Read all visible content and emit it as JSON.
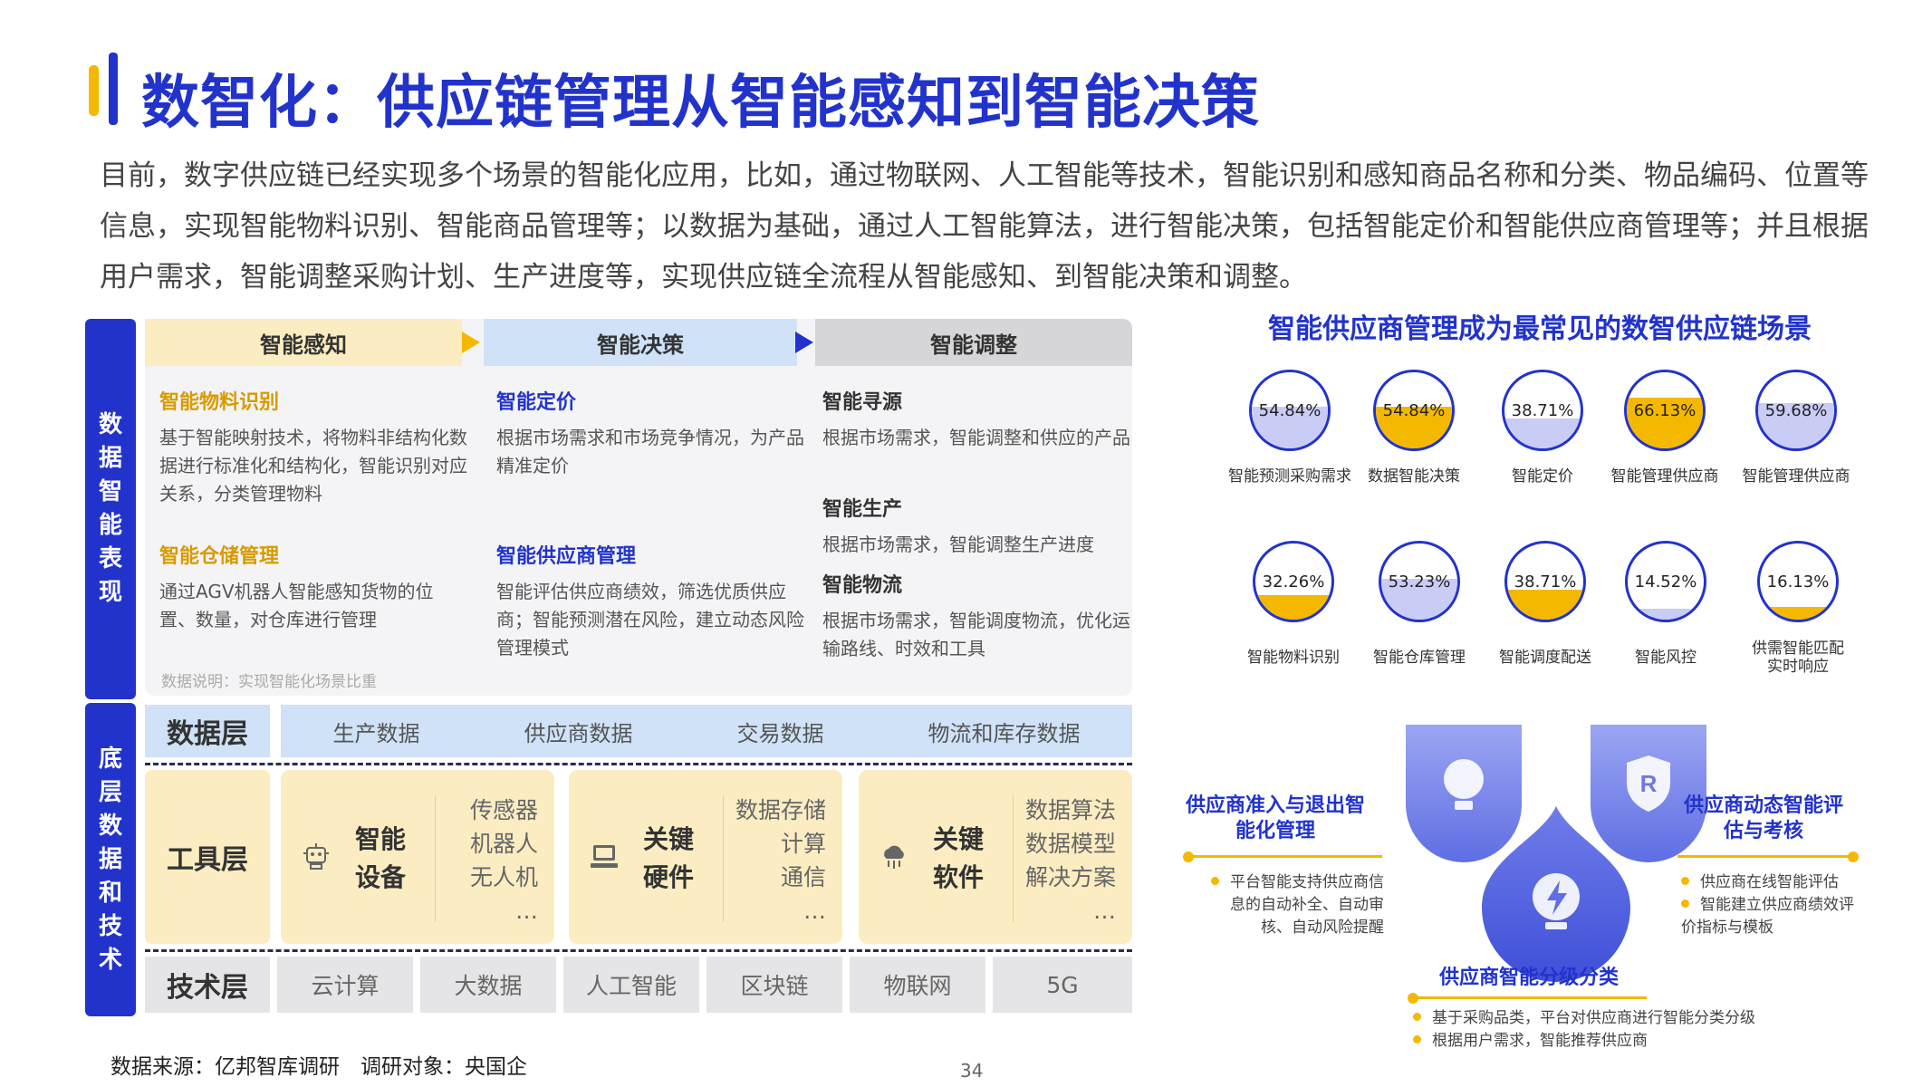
{
  "title": "数智化：供应链管理从智能感知到智能决策",
  "intro": "目前，数字供应链已经实现多个场景的智能化应用，比如，通过物联网、人工智能等技术，智能识别和感知商品名称和分类、物品编码、位置等信息，实现智能物料识别、智能商品管理等；以数据为基础，通过人工智能算法，进行智能决策，包括智能定价和智能供应商管理等；并且根据用户需求，智能调整采购计划、生产进度等，实现供应链全流程从智能感知、到智能决策和调整。",
  "left": {
    "side_top": "数据智能表现",
    "side_bottom": "底层数据和技术",
    "headers": [
      "智能感知",
      "智能决策",
      "智能调整"
    ],
    "col1": [
      {
        "title": "智能物料识别",
        "desc": "基于智能映射技术，将物料非结构化数据进行标准化和结构化，智能识别对应关系，分类管理物料"
      },
      {
        "title": "智能仓储管理",
        "desc": "通过AGV机器人智能感知货物的位置、数量，对仓库进行管理"
      }
    ],
    "col2": [
      {
        "title": "智能定价",
        "desc": "根据市场需求和市场竞争情况，为产品精准定价"
      },
      {
        "title": "智能供应商管理",
        "desc": "智能评估供应商绩效，筛选优质供应商；智能预测潜在风险，建立动态风险管理模式"
      }
    ],
    "col3": [
      {
        "title": "智能寻源",
        "desc": "根据市场需求，智能调整和供应的产品"
      },
      {
        "title": "智能生产",
        "desc": "根据市场需求，智能调整生产进度"
      },
      {
        "title": "智能物流",
        "desc": "根据市场需求，智能调度物流，优化运输路线、时效和工具"
      }
    ],
    "note": "数据说明：实现智能化场景比重",
    "data_layer": {
      "label": "数据层",
      "items": [
        "生产数据",
        "供应商数据",
        "交易数据",
        "物流和库存数据"
      ]
    },
    "tool_layer": {
      "label": "工具层",
      "cards": [
        {
          "name1": "智能",
          "name2": "设备",
          "list": [
            "传感器",
            "机器人",
            "无人机",
            "…"
          ]
        },
        {
          "name1": "关键",
          "name2": "硬件",
          "list": [
            "数据存储",
            "计算",
            "通信",
            "…"
          ]
        },
        {
          "name1": "关键",
          "name2": "软件",
          "list": [
            "数据算法",
            "数据模型",
            "解决方案",
            "…"
          ]
        }
      ]
    },
    "tech_layer": {
      "label": "技术层",
      "items": [
        "云计算",
        "大数据",
        "人工智能",
        "区块链",
        "物联网",
        "5G"
      ]
    }
  },
  "right": {
    "title": "智能供应商管理成为最常见的数智供应链场景",
    "gauges": [
      {
        "value": "54.84%",
        "pct": 54.84,
        "label": "智能预测采购需求",
        "color": "#c9ccf4"
      },
      {
        "value": "54.84%",
        "pct": 54.84,
        "label": "数据智能决策",
        "color": "#f5b800"
      },
      {
        "value": "38.71%",
        "pct": 38.71,
        "label": "智能定价",
        "color": "#c9ccf4"
      },
      {
        "value": "66.13%",
        "pct": 66.13,
        "label": "智能管理供应商",
        "color": "#f5b800"
      },
      {
        "value": "59.68%",
        "pct": 59.68,
        "label": "智能管理供应商",
        "color": "#c9ccf4"
      },
      {
        "value": "32.26%",
        "pct": 32.26,
        "label": "智能物料识别",
        "color": "#f5b800"
      },
      {
        "value": "53.23%",
        "pct": 53.23,
        "label": "智能仓库管理",
        "color": "#c9ccf4"
      },
      {
        "value": "38.71%",
        "pct": 38.71,
        "label": "智能调度配送",
        "color": "#f5b800"
      },
      {
        "value": "14.52%",
        "pct": 14.52,
        "label": "智能风控",
        "color": "#c9ccf4"
      },
      {
        "value": "16.13%",
        "pct": 16.13,
        "label": "供需智能匹配实时响应",
        "color": "#f5b800"
      }
    ],
    "block_left": {
      "title": "供应商准入与退出智能化管理",
      "bullet": "平台智能支持供应商信息的自动补全、自动审核、自动风险提醒"
    },
    "block_right": {
      "title": "供应商动态智能评估与考核",
      "bullets": [
        "供应商在线智能评估",
        "智能建立供应商绩效评价指标与模板"
      ]
    },
    "block_bottom": {
      "title": "供应商智能分级分类",
      "bullets": [
        "基于采购品类，平台对供应商进行智能分类分级",
        "根据用户需求，智能推荐供应商"
      ]
    }
  },
  "source": "数据来源：亿邦智库调研　调研对象：央国企",
  "page": "34",
  "colors": {
    "brand": "#2233cc",
    "accent": "#f5b800"
  }
}
